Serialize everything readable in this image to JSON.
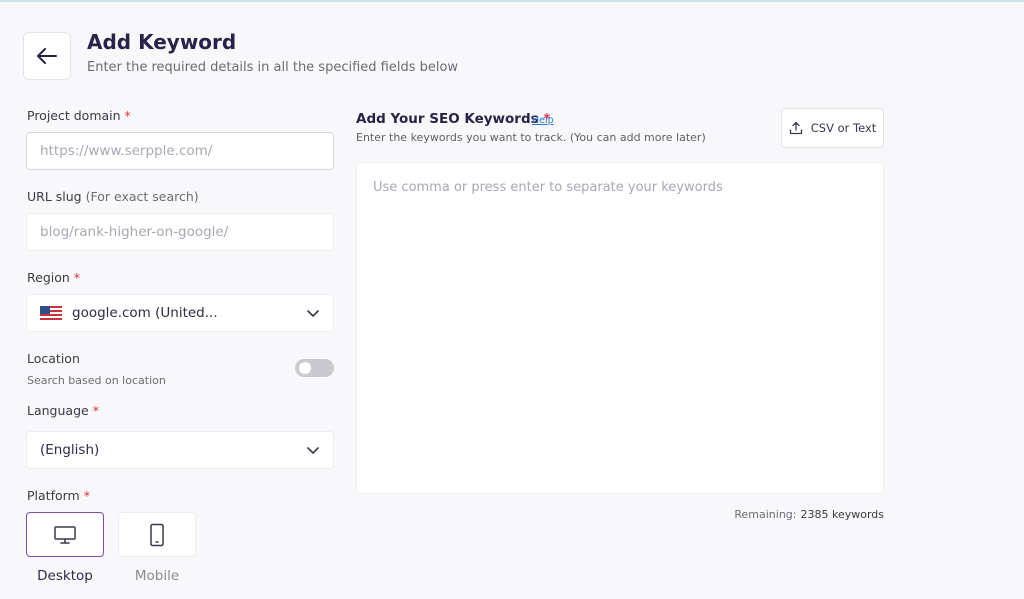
{
  "header": {
    "title": "Add Keyword",
    "subtitle": "Enter the required details in all the specified fields below"
  },
  "project_domain": {
    "label": "Project domain",
    "required_mark": "*",
    "placeholder": "https://www.serpple.com/"
  },
  "url_slug": {
    "label": "URL slug",
    "hint": "(For exact search)",
    "placeholder": "blog/rank-higher-on-google/"
  },
  "region": {
    "label": "Region",
    "required_mark": "*",
    "value": "google.com (United...",
    "flag_icon": "us-flag-icon"
  },
  "location": {
    "label": "Location",
    "hint": "Search based on location",
    "enabled": false
  },
  "language": {
    "label": "Language",
    "required_mark": "*",
    "value": "(English)"
  },
  "platform": {
    "label": "Platform",
    "required_mark": "*",
    "options": [
      {
        "label": "Desktop",
        "icon": "desktop-icon",
        "selected": true
      },
      {
        "label": "Mobile",
        "icon": "mobile-icon",
        "selected": false
      }
    ]
  },
  "keywords": {
    "title": "Add Your SEO Keywords",
    "required_mark": "*",
    "help_label": "Help",
    "description": "Enter the keywords you want to track. (You can add more later)",
    "upload_label": "CSV or Text",
    "placeholder": "Use comma or press enter to separate your keywords",
    "remaining_label": "Remaining:",
    "remaining_count": "2385 keywords"
  },
  "colors": {
    "accent": "#7a4fb0",
    "required": "#e0313f",
    "link": "#2e7bd6",
    "title": "#2a2248"
  }
}
